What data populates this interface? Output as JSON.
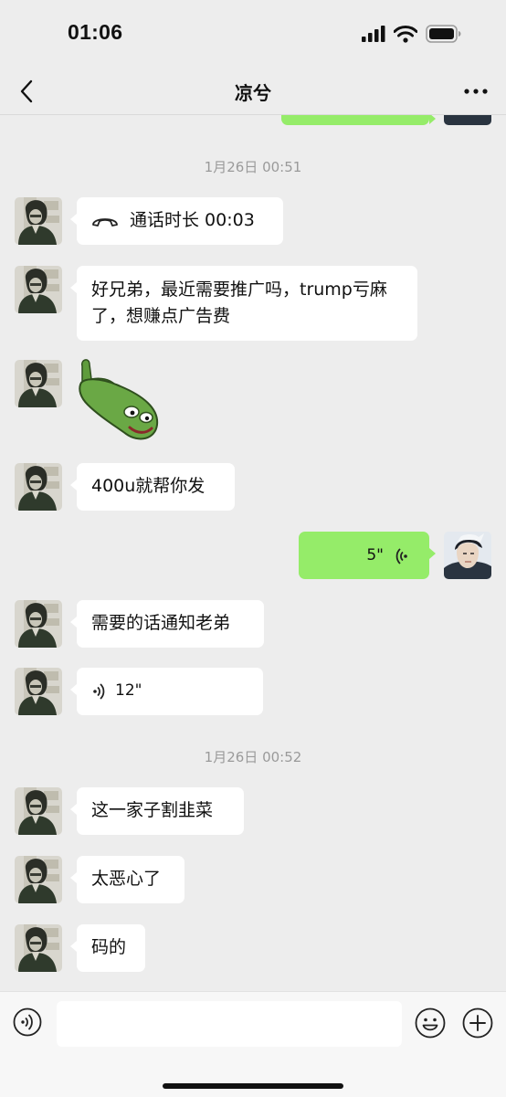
{
  "status_bar": {
    "time": "01:06"
  },
  "header": {
    "title": "凉兮"
  },
  "messages": [
    {
      "kind": "timestamp",
      "text": "1月26日 00:51"
    },
    {
      "kind": "call",
      "from": "contact",
      "text": "通话时长 00:03"
    },
    {
      "kind": "text",
      "from": "contact",
      "text": "好兄弟，最近需要推广吗，trump亏麻了，想赚点广告费"
    },
    {
      "kind": "sticker",
      "from": "contact",
      "sticker": "pepe-frog-thumbs-up"
    },
    {
      "kind": "text",
      "from": "contact",
      "text": "400u就帮你发"
    },
    {
      "kind": "voice",
      "from": "me",
      "duration": "5\""
    },
    {
      "kind": "text",
      "from": "contact",
      "text": "需要的话通知老弟"
    },
    {
      "kind": "voice",
      "from": "contact",
      "duration": "12\""
    },
    {
      "kind": "timestamp",
      "text": "1月26日 00:52"
    },
    {
      "kind": "text",
      "from": "contact",
      "text": "这一家子割韭菜"
    },
    {
      "kind": "text",
      "from": "contact",
      "text": "太恶心了"
    },
    {
      "kind": "text",
      "from": "contact",
      "text": "码的"
    }
  ],
  "input_bar": {
    "text_value": ""
  },
  "colors": {
    "background": "#ededed",
    "bubble_me": "#95ec69",
    "bubble_contact": "#ffffff",
    "timestamp": "#9a9a9a"
  },
  "icons": [
    "back-icon",
    "more-icon",
    "phone-call-icon",
    "voice-wave-icon",
    "voice-input-icon",
    "emoji-icon",
    "plus-icon"
  ]
}
